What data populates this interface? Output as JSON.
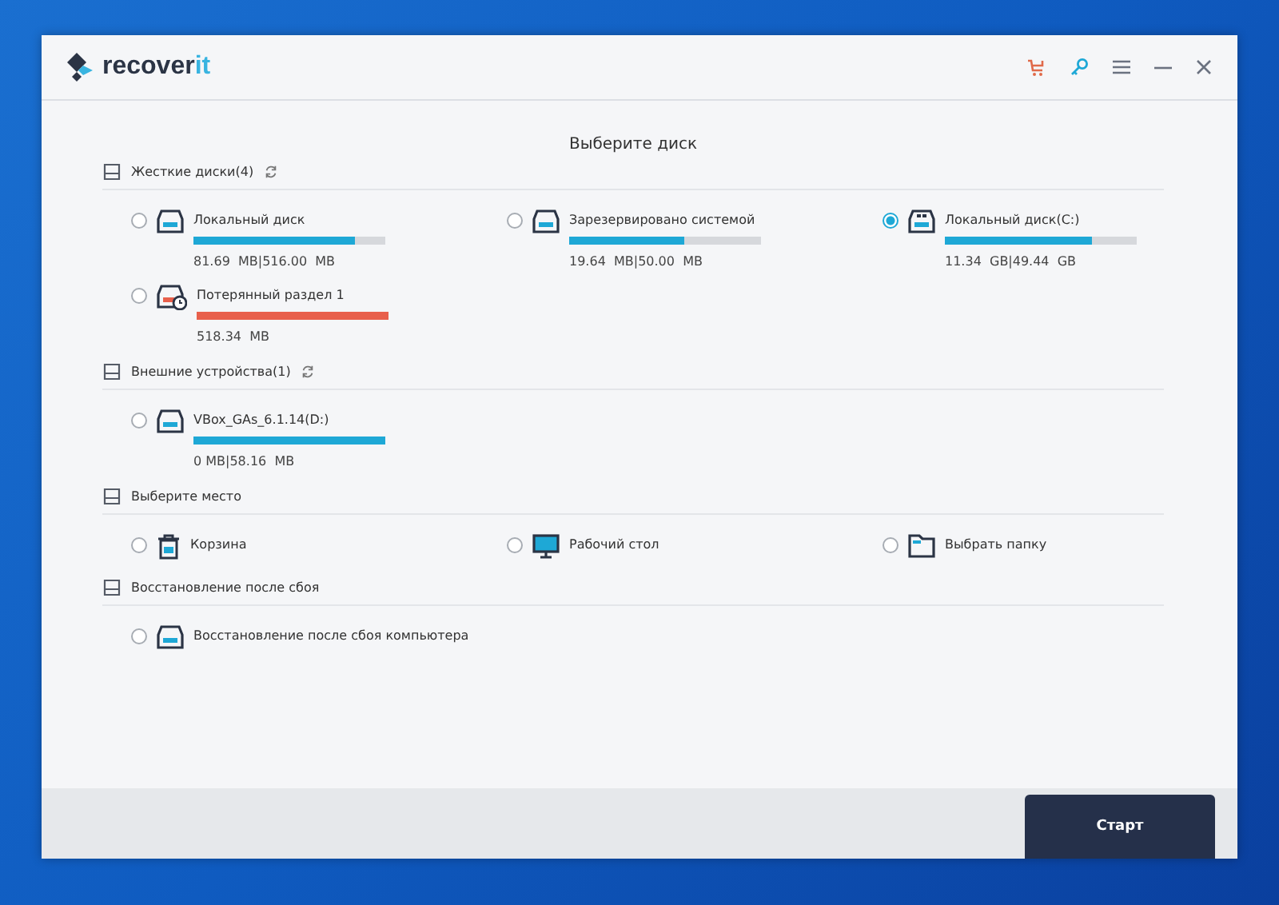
{
  "app": {
    "logo_text": "recover",
    "logo_accent": "it"
  },
  "toolbar": [
    {
      "kind": "cart"
    },
    {
      "kind": "key"
    },
    {
      "kind": "menu"
    },
    {
      "kind": "minimize"
    },
    {
      "kind": "close"
    }
  ],
  "heading": "Выберите диск",
  "sections": [
    {
      "title": "Жесткие диски(4)",
      "refresh": true,
      "items": [
        {
          "kind": "drive",
          "name": "Локальный диск",
          "selected": false,
          "level": 0.84,
          "reading": "81.69  MB|516.00  MB"
        },
        {
          "kind": "drive",
          "name": "Зарезервировано системой",
          "selected": false,
          "level": 0.6,
          "reading": "19.64  MB|50.00  MB"
        },
        {
          "kind": "windows-drive",
          "name": "Локальный диск(C:)",
          "selected": true,
          "level": 0.77,
          "reading": "11.34  GB|49.44  GB"
        },
        {
          "kind": "lost-drive",
          "name": "Потерянный раздел 1",
          "selected": false,
          "level": 1,
          "reading": "518.34  MB"
        }
      ]
    },
    {
      "title": "Внешние устройства(1)",
      "refresh": true,
      "items": [
        {
          "kind": "drive",
          "name": "VBox_GAs_6.1.14(D:)",
          "selected": false,
          "level": 1,
          "reading": "0 MB|58.16  MB"
        }
      ]
    },
    {
      "title": "Выберите место",
      "refresh": false,
      "items": [
        {
          "kind": "trash",
          "name": "Корзина",
          "selected": false
        },
        {
          "kind": "desktop",
          "name": "Рабочий стол",
          "selected": false
        },
        {
          "kind": "folder",
          "name": "Выбрать папку",
          "selected": false
        }
      ]
    },
    {
      "title": "Восстановление после сбоя",
      "refresh": false,
      "items": [
        {
          "kind": "crash",
          "name": "Восстановление после сбоя компьютера",
          "selected": false
        }
      ]
    }
  ],
  "start_button": "Старт"
}
